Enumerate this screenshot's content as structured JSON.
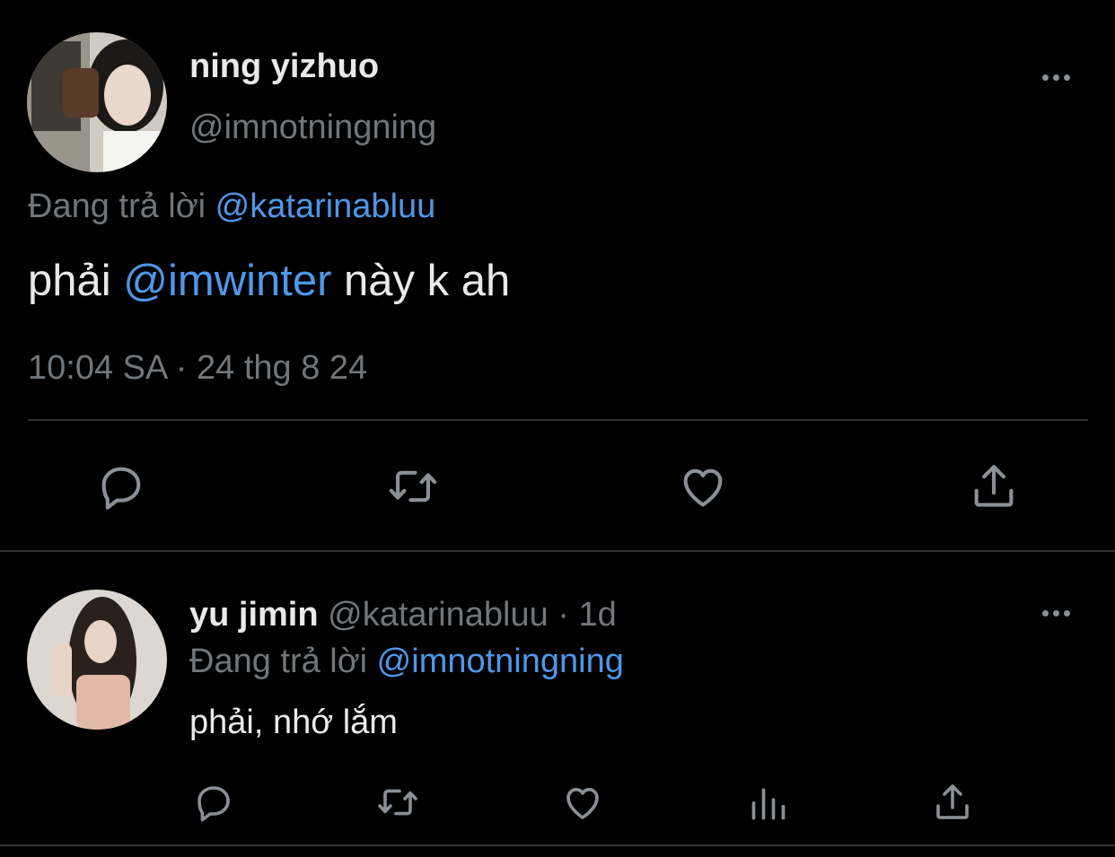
{
  "main_tweet": {
    "display_name": "ning yizhuo",
    "handle": "@imnotningning",
    "replying_prefix": "Đang trả lời",
    "replying_to": "@katarinabluu",
    "text_before": "phải ",
    "mention": "@imwinter",
    "text_after": " này k ah",
    "timestamp": "10:04 SA · 24 thg 8 24"
  },
  "reply_tweet": {
    "display_name": "yu jimin",
    "handle": "@katarinabluu",
    "time_sep": " · ",
    "time": "1d",
    "replying_prefix": "Đang trả lời",
    "replying_to": "@imnotningning",
    "text": "phải, nhớ lắm"
  },
  "icons": {
    "reply": "reply-icon",
    "retweet": "retweet-icon",
    "like": "heart-icon",
    "views": "views-icon",
    "share": "share-icon",
    "more": "more-icon"
  },
  "colors": {
    "background": "#000000",
    "text": "#e7e9ea",
    "muted": "#71767b",
    "link": "#4f97e8",
    "divider": "#2f3336"
  }
}
